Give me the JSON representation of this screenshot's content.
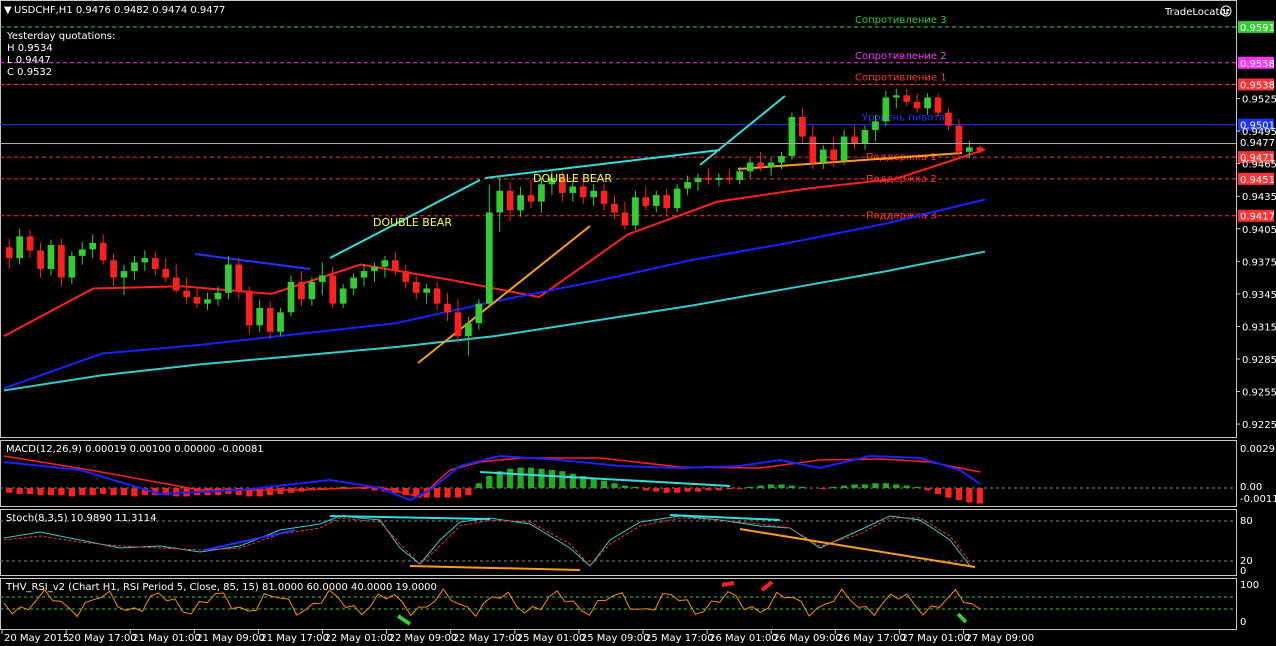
{
  "header": {
    "symbol_line": "USDCHF,H1  0.9476 0.9482 0.9474 0.9477",
    "yesterday_title": "Yesterday quotations:",
    "yesterday_h": "H 0.9534",
    "yesterday_l": "L 0.9447",
    "yesterday_c": "C 0.9532",
    "brand": "TradeLocator",
    "brand_icon": "smiley-icon"
  },
  "levels": [
    {
      "label": "Сопротивление 3",
      "price_label": "0.9591",
      "color": "#33cc33",
      "label_color": "#33cc33",
      "box_bg": "#33cc33"
    },
    {
      "label": "Сопротивление 2",
      "price_label": "0.9558",
      "color": "#ff33ff",
      "label_color": "#ff33ff",
      "box_bg": "#ff33ff"
    },
    {
      "label": "Сопротивление 1",
      "price_label": "0.9538",
      "color": "#ff3333",
      "label_color": "#ff3333",
      "box_bg": "#ff3333"
    },
    {
      "label": "Уровень пивота",
      "price_label": "0.9501",
      "color": "#1a33ff",
      "label_color": "#1a33ff",
      "box_bg": "#1a33ff"
    },
    {
      "label": "Поддержка 1",
      "price_label": "0.9471",
      "color": "#ff3333",
      "label_color": "#ff3333",
      "box_bg": "#ff3333"
    },
    {
      "label": "Поддержка 2",
      "price_label": "0.9451",
      "color": "#ff3333",
      "label_color": "#ff3333",
      "box_bg": "#ff3333"
    },
    {
      "label": "Поддержка 3",
      "price_label": "0.9417",
      "color": "#ff3333",
      "label_color": "#ff3333",
      "box_bg": "#ff3333"
    }
  ],
  "current_price_label": "0.9477",
  "patterns": [
    "DOUBLE  BEAR",
    "DOUBLE  BEAR"
  ],
  "indicators": {
    "macd": {
      "label": "MACD(12,26,9) 0.00019 0.00100 0.00000 -0.00081",
      "ticks": [
        "0.00295",
        "0.00",
        "-0.00112"
      ]
    },
    "stoch": {
      "label": "Stoch(8,3,5) 10.9890 11.3114",
      "ticks": [
        "80",
        "20",
        "0"
      ]
    },
    "rsi": {
      "label": "THV_RSI_v2  (Chart H1,  RSI Period 5,  Close,  85,  15)  81.0000 60.0000 40.0000 19.0000",
      "ticks": [
        "100",
        "0"
      ]
    }
  },
  "chart_data": {
    "type": "candlestick",
    "symbol": "USDCHF",
    "timeframe": "H1",
    "ylim": [
      0.9214,
      0.9614
    ],
    "y_ticks": [
      "0.9525",
      "0.9495",
      "0.9465",
      "0.9435",
      "0.9405",
      "0.9375",
      "0.9345",
      "0.9315",
      "0.9285",
      "0.9255",
      "0.9225"
    ],
    "x_ticks": [
      "20 May 2015",
      "20 May 17:00",
      "21 May 01:00",
      "21 May 09:00",
      "21 May 17:00",
      "22 May 01:00",
      "22 May 09:00",
      "22 May 17:00",
      "25 May 01:00",
      "25 May 09:00",
      "25 May 17:00",
      "26 May 01:00",
      "26 May 09:00",
      "26 May 17:00",
      "27 May 01:00",
      "27 May 09:00"
    ],
    "candles": [
      [
        0.9388,
        0.9396,
        0.9368,
        0.9378
      ],
      [
        0.9378,
        0.9405,
        0.9372,
        0.9398
      ],
      [
        0.9398,
        0.9404,
        0.9378,
        0.9385
      ],
      [
        0.9385,
        0.9392,
        0.936,
        0.9368
      ],
      [
        0.9368,
        0.9395,
        0.9362,
        0.939
      ],
      [
        0.939,
        0.9396,
        0.9352,
        0.936
      ],
      [
        0.936,
        0.9384,
        0.9354,
        0.938
      ],
      [
        0.938,
        0.9393,
        0.9372,
        0.9386
      ],
      [
        0.9386,
        0.94,
        0.9378,
        0.9392
      ],
      [
        0.9392,
        0.94,
        0.9372,
        0.9376
      ],
      [
        0.9376,
        0.9382,
        0.9352,
        0.936
      ],
      [
        0.936,
        0.9372,
        0.9344,
        0.9366
      ],
      [
        0.9366,
        0.938,
        0.9358,
        0.9374
      ],
      [
        0.9374,
        0.9385,
        0.9366,
        0.9378
      ],
      [
        0.9378,
        0.9384,
        0.9362,
        0.9368
      ],
      [
        0.9368,
        0.9378,
        0.9356,
        0.936
      ],
      [
        0.936,
        0.9372,
        0.9346,
        0.9348
      ],
      [
        0.9348,
        0.936,
        0.9336,
        0.9342
      ],
      [
        0.9342,
        0.935,
        0.9332,
        0.9336
      ],
      [
        0.9336,
        0.9346,
        0.933,
        0.934
      ],
      [
        0.934,
        0.9352,
        0.9334,
        0.9346
      ],
      [
        0.9346,
        0.938,
        0.934,
        0.9372
      ],
      [
        0.9372,
        0.9378,
        0.934,
        0.9348
      ],
      [
        0.9348,
        0.9352,
        0.9308,
        0.9316
      ],
      [
        0.9316,
        0.934,
        0.931,
        0.9332
      ],
      [
        0.9332,
        0.9338,
        0.9304,
        0.931
      ],
      [
        0.931,
        0.9332,
        0.9306,
        0.9328
      ],
      [
        0.9328,
        0.9362,
        0.9324,
        0.9356
      ],
      [
        0.9356,
        0.9366,
        0.9334,
        0.934
      ],
      [
        0.934,
        0.936,
        0.9334,
        0.9356
      ],
      [
        0.9356,
        0.9374,
        0.9344,
        0.9362
      ],
      [
        0.9362,
        0.937,
        0.9332,
        0.9336
      ],
      [
        0.9336,
        0.9354,
        0.9332,
        0.935
      ],
      [
        0.935,
        0.9364,
        0.9344,
        0.936
      ],
      [
        0.936,
        0.9372,
        0.9352,
        0.9366
      ],
      [
        0.9366,
        0.9374,
        0.9356,
        0.937
      ],
      [
        0.937,
        0.938,
        0.936,
        0.9376
      ],
      [
        0.9376,
        0.9384,
        0.9362,
        0.9366
      ],
      [
        0.9366,
        0.9372,
        0.935,
        0.9356
      ],
      [
        0.9356,
        0.9362,
        0.934,
        0.9346
      ],
      [
        0.9346,
        0.9354,
        0.9336,
        0.935
      ],
      [
        0.935,
        0.9356,
        0.933,
        0.9336
      ],
      [
        0.9336,
        0.9346,
        0.932,
        0.9328
      ],
      [
        0.9328,
        0.934,
        0.93,
        0.9306
      ],
      [
        0.9306,
        0.9324,
        0.9288,
        0.9318
      ],
      [
        0.9318,
        0.934,
        0.9312,
        0.9336
      ],
      [
        0.9336,
        0.9446,
        0.9334,
        0.942
      ],
      [
        0.942,
        0.9454,
        0.9402,
        0.944
      ],
      [
        0.944,
        0.9448,
        0.9412,
        0.9422
      ],
      [
        0.9422,
        0.9444,
        0.9416,
        0.9436
      ],
      [
        0.9436,
        0.945,
        0.9424,
        0.943
      ],
      [
        0.943,
        0.9452,
        0.942,
        0.9446
      ],
      [
        0.9446,
        0.946,
        0.9436,
        0.9452
      ],
      [
        0.9452,
        0.9458,
        0.943,
        0.9438
      ],
      [
        0.9438,
        0.945,
        0.943,
        0.9444
      ],
      [
        0.9444,
        0.9452,
        0.9428,
        0.9434
      ],
      [
        0.9434,
        0.9446,
        0.9426,
        0.944
      ],
      [
        0.944,
        0.9446,
        0.9422,
        0.9428
      ],
      [
        0.9428,
        0.9436,
        0.9414,
        0.942
      ],
      [
        0.942,
        0.943,
        0.9404,
        0.9408
      ],
      [
        0.9408,
        0.944,
        0.9404,
        0.9434
      ],
      [
        0.9434,
        0.9444,
        0.9422,
        0.9426
      ],
      [
        0.9426,
        0.944,
        0.942,
        0.9436
      ],
      [
        0.9436,
        0.9442,
        0.9418,
        0.9424
      ],
      [
        0.9424,
        0.9446,
        0.942,
        0.9442
      ],
      [
        0.9442,
        0.9454,
        0.9436,
        0.9448
      ],
      [
        0.9448,
        0.9456,
        0.944,
        0.9452
      ],
      [
        0.9452,
        0.946,
        0.9446,
        0.945
      ],
      [
        0.945,
        0.9456,
        0.9444,
        0.9452
      ],
      [
        0.9452,
        0.946,
        0.9446,
        0.945
      ],
      [
        0.945,
        0.9462,
        0.9446,
        0.9458
      ],
      [
        0.9458,
        0.947,
        0.9452,
        0.9466
      ],
      [
        0.9466,
        0.9476,
        0.9458,
        0.9462
      ],
      [
        0.9462,
        0.947,
        0.9454,
        0.9466
      ],
      [
        0.9466,
        0.9476,
        0.946,
        0.9472
      ],
      [
        0.9472,
        0.9512,
        0.9468,
        0.9508
      ],
      [
        0.9508,
        0.9516,
        0.9484,
        0.949
      ],
      [
        0.949,
        0.95,
        0.946,
        0.9466
      ],
      [
        0.9466,
        0.9482,
        0.946,
        0.9478
      ],
      [
        0.9478,
        0.949,
        0.9462,
        0.9468
      ],
      [
        0.9468,
        0.9496,
        0.9464,
        0.949
      ],
      [
        0.949,
        0.95,
        0.9478,
        0.9484
      ],
      [
        0.9484,
        0.95,
        0.9478,
        0.9496
      ],
      [
        0.9496,
        0.951,
        0.9486,
        0.9504
      ],
      [
        0.9504,
        0.9532,
        0.95,
        0.9526
      ],
      [
        0.9526,
        0.9534,
        0.9516,
        0.9528
      ],
      [
        0.9528,
        0.9534,
        0.9518,
        0.9522
      ],
      [
        0.9522,
        0.953,
        0.9512,
        0.9516
      ],
      [
        0.9516,
        0.953,
        0.951,
        0.9526
      ],
      [
        0.9526,
        0.953,
        0.9508,
        0.9512
      ],
      [
        0.9512,
        0.9516,
        0.9496,
        0.95
      ],
      [
        0.95,
        0.9506,
        0.947,
        0.9476
      ],
      [
        0.9476,
        0.9486,
        0.947,
        0.948
      ],
      [
        0.948,
        0.9482,
        0.9474,
        0.9477
      ]
    ],
    "ma_series": [
      {
        "color": "#ff2020",
        "values": [
          0.9306,
          0.935,
          0.9352,
          0.9345,
          0.9372,
          0.9358,
          0.9342,
          0.94,
          0.943,
          0.9442,
          0.9451,
          0.9478
        ]
      },
      {
        "color": "#1a22ff",
        "values": [
          0.9258,
          0.929,
          0.9298,
          0.9308,
          0.9318,
          0.9338,
          0.9356,
          0.9376,
          0.9392,
          0.941,
          0.9432
        ]
      },
      {
        "color": "#33cccc",
        "values": [
          0.9256,
          0.927,
          0.928,
          0.9288,
          0.9296,
          0.9306,
          0.932,
          0.9334,
          0.935,
          0.9366,
          0.9384
        ]
      }
    ]
  }
}
